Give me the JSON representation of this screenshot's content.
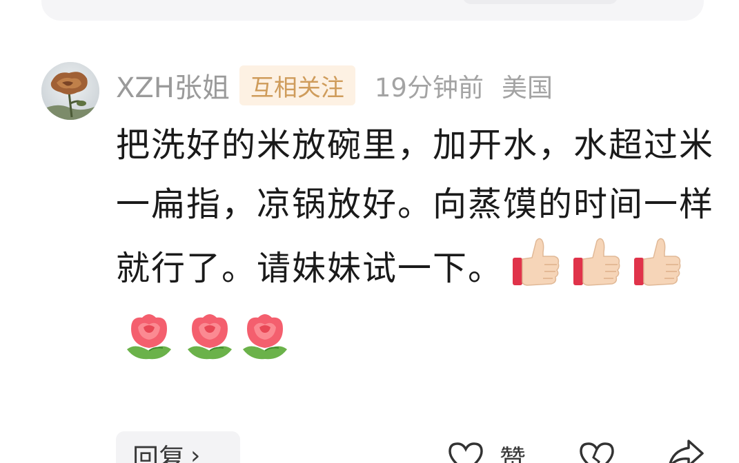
{
  "comment": {
    "username": "XZH张姐",
    "relation_badge": "互相关注",
    "time_ago": "19分钟前",
    "location": "美国",
    "text": "把洗好的米放碗里，加开水，水超过米一扁指，凉锅放好。向蒸馍的时间一样就行了。请妹妹试一下。",
    "emojis": [
      "thumbs-up",
      "thumbs-up",
      "thumbs-up",
      "rose",
      "rose",
      "rose"
    ]
  },
  "actions": {
    "reply_label": "回复",
    "reply_arrow": "›",
    "like_label": "赞"
  },
  "colors": {
    "badge_bg": "#fdf1e3",
    "badge_text": "#cf9c5b",
    "meta_text": "#a3a3a3",
    "body_text": "#1a1a1a"
  }
}
